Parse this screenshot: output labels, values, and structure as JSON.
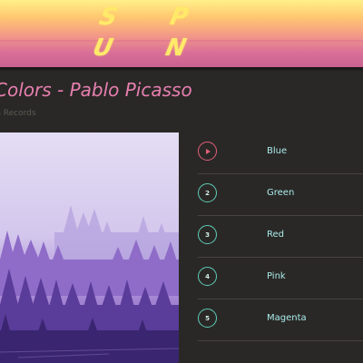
{
  "header": {
    "logo": "S P U N",
    "colors": {
      "top": "#fff08a",
      "bottom": "#c9628f",
      "logo": "#ffe96a"
    }
  },
  "album": {
    "title": "Colors - Pablo Picasso",
    "label": "ish Records",
    "title_color": "#e77fb0",
    "cover_icon": "forest-album-art"
  },
  "tracks": [
    {
      "number": "",
      "name": "Blue",
      "state": "playing",
      "icon": "play-icon"
    },
    {
      "number": "2",
      "name": "Green"
    },
    {
      "number": "3",
      "name": "Red"
    },
    {
      "number": "4",
      "name": "Pink"
    },
    {
      "number": "5",
      "name": "Magenta"
    }
  ],
  "colors": {
    "background": "#2a2826",
    "accent_active": "#e0607a",
    "accent_teal": "#5ecdb8",
    "track_text": "#a9ecec"
  }
}
